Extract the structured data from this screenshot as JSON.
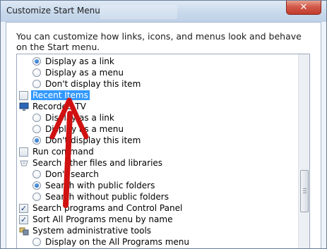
{
  "window": {
    "title": "Customize Start Menu",
    "close_glyph": "✕"
  },
  "description": "You can customize how links, icons, and menus look and behave on the Start menu.",
  "items": [
    {
      "type": "radio",
      "label": "Display as a link",
      "checked": true
    },
    {
      "type": "radio",
      "label": "Display as a menu",
      "checked": false
    },
    {
      "type": "radio",
      "label": "Don't display this item",
      "checked": false
    },
    {
      "type": "checkbox",
      "label": "Recent Items",
      "checked": false,
      "selected": true
    },
    {
      "type": "header",
      "label": "Recorded TV",
      "icon": "monitor-icon"
    },
    {
      "type": "radio",
      "label": "Display as a link",
      "checked": false
    },
    {
      "type": "radio",
      "label": "Display as a menu",
      "checked": false
    },
    {
      "type": "radio",
      "label": "Don't display this item",
      "checked": true
    },
    {
      "type": "checkbox",
      "label": "Run command",
      "checked": false
    },
    {
      "type": "header",
      "label": "Search other files and libraries",
      "icon": "search-scope-icon"
    },
    {
      "type": "radio",
      "label": "Don't search",
      "checked": false
    },
    {
      "type": "radio",
      "label": "Search with public folders",
      "checked": true
    },
    {
      "type": "radio",
      "label": "Search without public folders",
      "checked": false
    },
    {
      "type": "checkbox",
      "label": "Search programs and Control Panel",
      "checked": true
    },
    {
      "type": "checkbox",
      "label": "Sort All Programs menu by name",
      "checked": true
    },
    {
      "type": "header",
      "label": "System administrative tools",
      "icon": "admin-tools-icon"
    },
    {
      "type": "radio",
      "label": "Display on the All Programs menu",
      "checked": false
    }
  ],
  "check_glyph": "✓",
  "colors": {
    "selection": "#3399ff",
    "arrow": "#d11111"
  }
}
